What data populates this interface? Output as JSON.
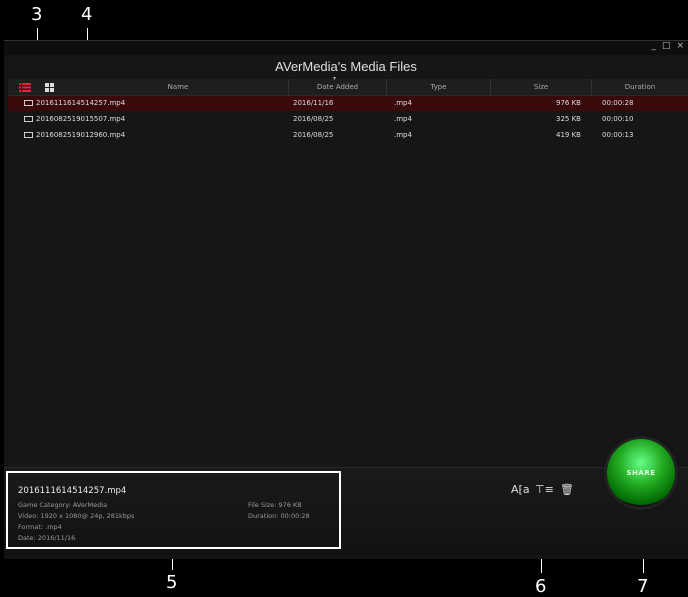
{
  "callouts": {
    "c3": "3",
    "c4": "4",
    "c5": "5",
    "c6": "6",
    "c7": "7"
  },
  "window": {
    "title": "AVerMedia's Media Files",
    "controls": {
      "minimize": "_",
      "maximize": "□",
      "close": "×"
    }
  },
  "table": {
    "headers": {
      "name": "Name",
      "date": "Date Added",
      "type": "Type",
      "size": "Size",
      "duration": "Duration"
    },
    "rows": [
      {
        "name": "20161116145142​57.mp4",
        "date": "2016/11/16",
        "type": ".mp4",
        "size": "976 KB",
        "duration": "00:00:28"
      },
      {
        "name": "20160825190155​07.mp4",
        "date": "2016/08/25",
        "type": ".mp4",
        "size": "325 KB",
        "duration": "00:00:10"
      },
      {
        "name": "20160825190129​60.mp4",
        "date": "2016/08/25",
        "type": ".mp4",
        "size": "419 KB",
        "duration": "00:00:13"
      }
    ]
  },
  "details": {
    "filename": "20161116145142​57.mp4",
    "game_category": "Game Category:  AVerMedia",
    "video": "Video:  1920 x 1080@ 24p, 281kbps",
    "format": "Format:  .mp4",
    "date": "Date:  2016/11/16",
    "file_size": "File Size:  976 KB",
    "duration": "Duration:  00:00:28"
  },
  "toolbar": {
    "rename_icon": "A⁅a",
    "edit_icon": "⊤≡",
    "delete_icon": "🗑"
  },
  "share": {
    "label": "SHARE"
  },
  "colors": {
    "selected_row": "#3a0a0a",
    "accent_red": "#e23",
    "share_green": "#2a2"
  }
}
